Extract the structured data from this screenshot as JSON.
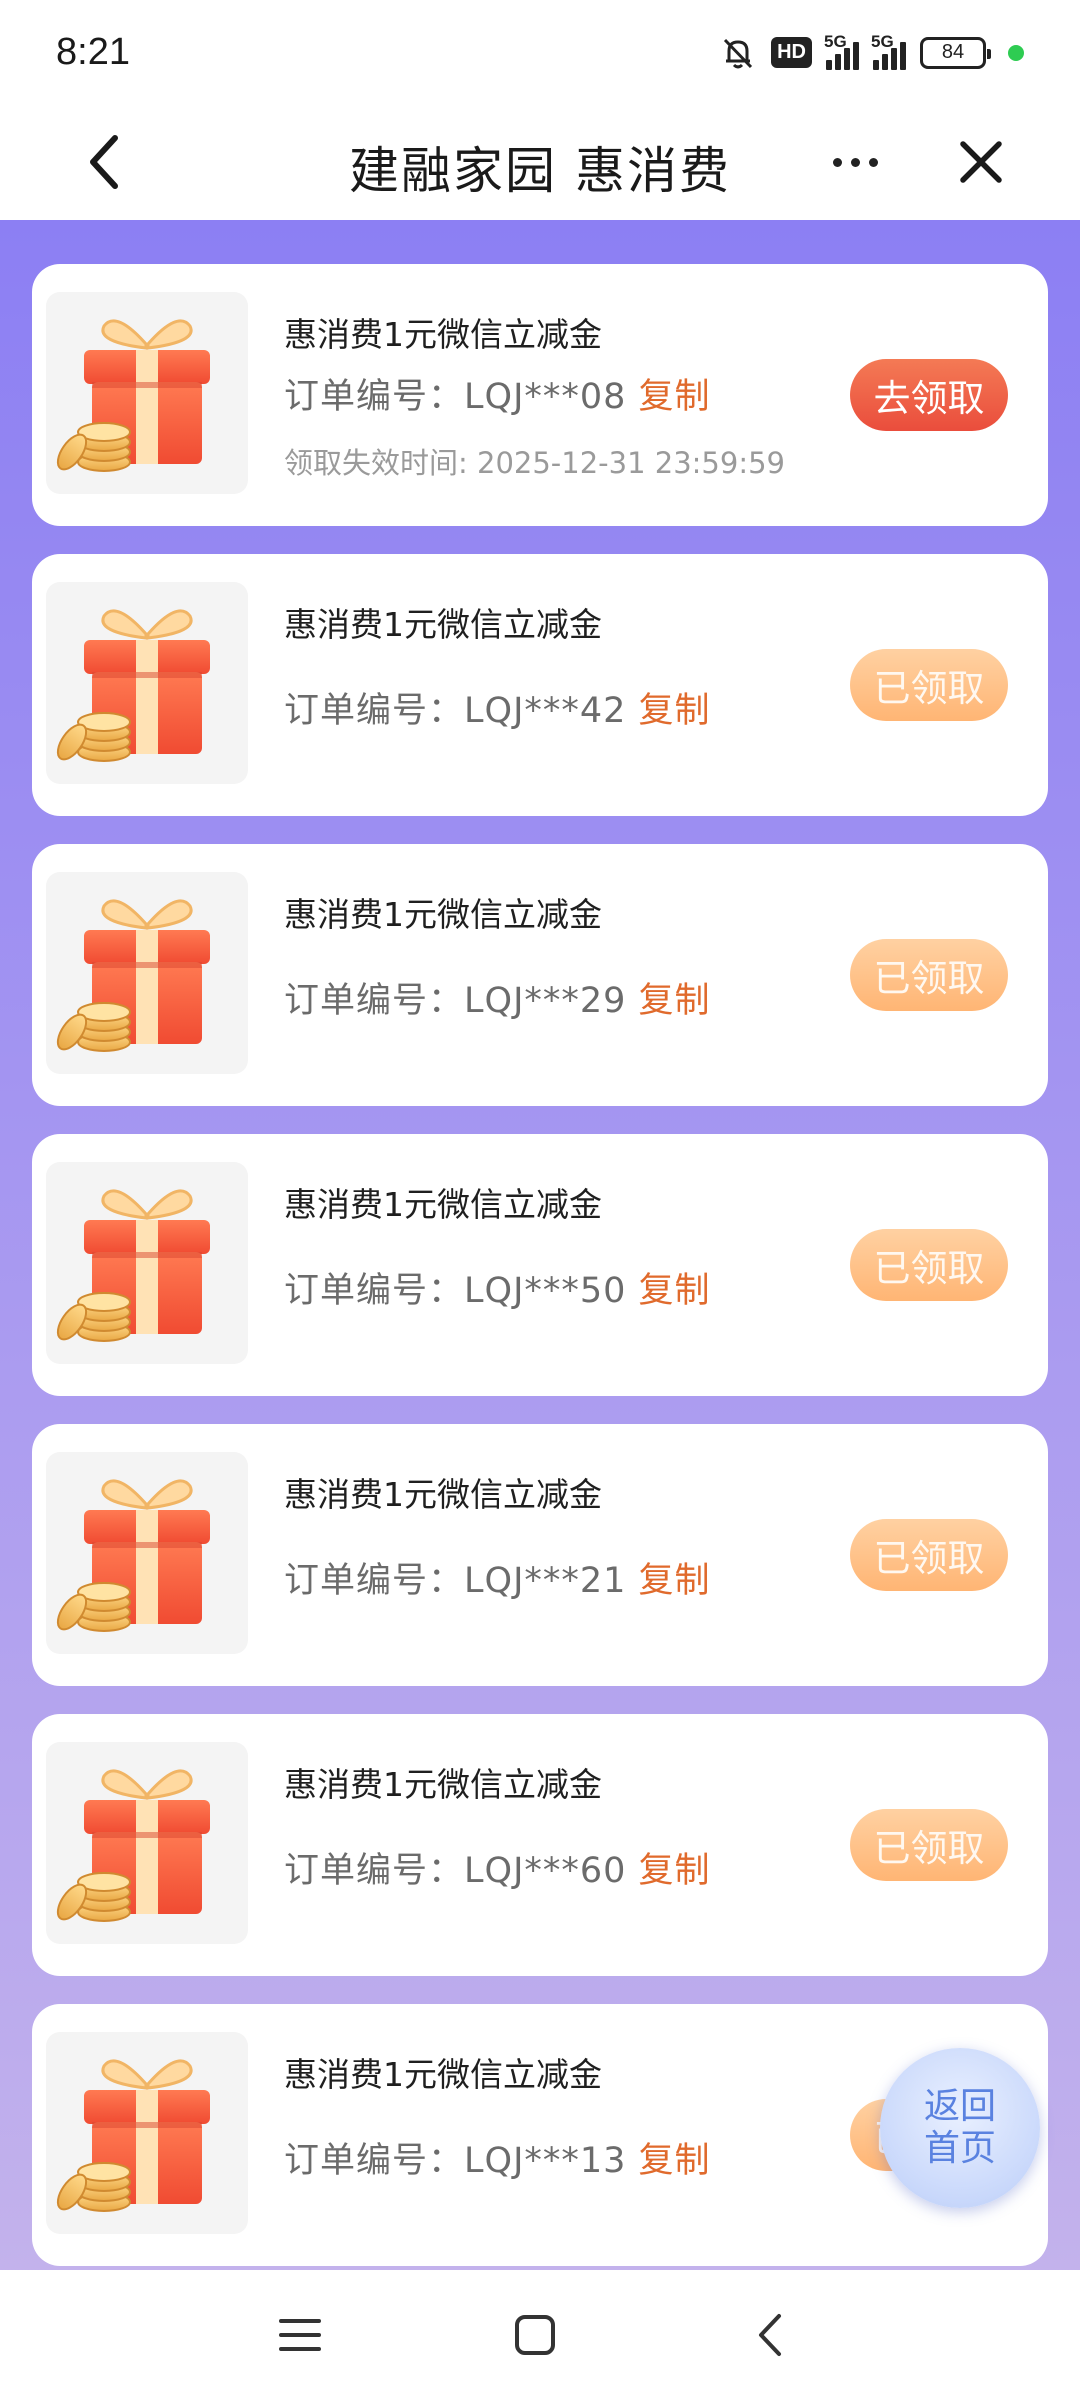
{
  "status_bar": {
    "time": "8:21",
    "hd_label": "HD",
    "sim1_label": "5G",
    "sim2_label": "5G",
    "battery": "84"
  },
  "nav": {
    "title": "建融家园 惠消费"
  },
  "colors": {
    "bg_top": "#8c7ff3",
    "bg_bottom": "#c3b2ec",
    "claim_active": "#ea4d3c",
    "claim_done": "#ffb574",
    "copy_link": "#e06a2c"
  },
  "cards": [
    {
      "title": "惠消费1元微信立减金",
      "order_label": "订单编号：",
      "order_no": "LQJ***08",
      "copy": "复制",
      "expire": "领取失效时间: 2025-12-31 23:59:59",
      "button": "去领取",
      "state": "active"
    },
    {
      "title": "惠消费1元微信立减金",
      "order_label": "订单编号：",
      "order_no": "LQJ***42",
      "copy": "复制",
      "button": "已领取",
      "state": "done"
    },
    {
      "title": "惠消费1元微信立减金",
      "order_label": "订单编号：",
      "order_no": "LQJ***29",
      "copy": "复制",
      "button": "已领取",
      "state": "done"
    },
    {
      "title": "惠消费1元微信立减金",
      "order_label": "订单编号：",
      "order_no": "LQJ***50",
      "copy": "复制",
      "button": "已领取",
      "state": "done"
    },
    {
      "title": "惠消费1元微信立减金",
      "order_label": "订单编号：",
      "order_no": "LQJ***21",
      "copy": "复制",
      "button": "已领取",
      "state": "done"
    },
    {
      "title": "惠消费1元微信立减金",
      "order_label": "订单编号：",
      "order_no": "LQJ***60",
      "copy": "复制",
      "button": "已领取",
      "state": "done"
    },
    {
      "title": "惠消费1元微信立减金",
      "order_label": "订单编号：",
      "order_no": "LQJ***13",
      "copy": "复制",
      "button": "已领取",
      "state": "done"
    }
  ],
  "float_button": {
    "line1": "返回",
    "line2": "首页"
  },
  "icons": {
    "back": "chevron-left-icon",
    "more": "more-dots-icon",
    "close": "close-icon",
    "gift": "gift-box-icon",
    "menu": "menu-icon",
    "home": "home-square-icon",
    "sys_back": "back-arrow-icon"
  }
}
